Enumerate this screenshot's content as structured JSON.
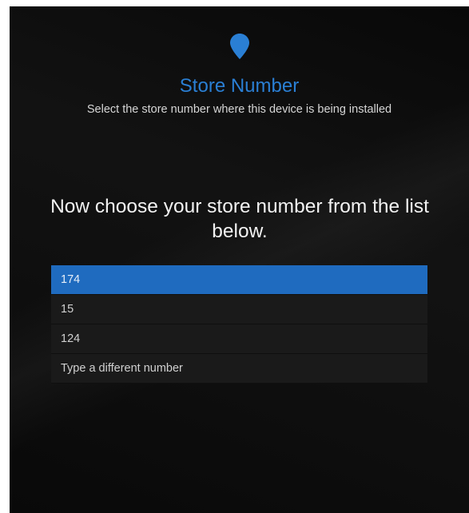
{
  "header": {
    "icon": "location-pin-icon",
    "title": "Store Number",
    "subtitle": "Select the store number where this device is being installed"
  },
  "prompt": "Now choose your store number from the list below.",
  "store_list": {
    "selected_index": 0,
    "items": [
      {
        "label": "174"
      },
      {
        "label": "15"
      },
      {
        "label": "124"
      },
      {
        "label": "Type a different number"
      }
    ]
  },
  "colors": {
    "accent": "#2a7fd4",
    "selected_row": "#1f6bbf",
    "background": "#121212",
    "row_background": "#1a1a1a"
  }
}
